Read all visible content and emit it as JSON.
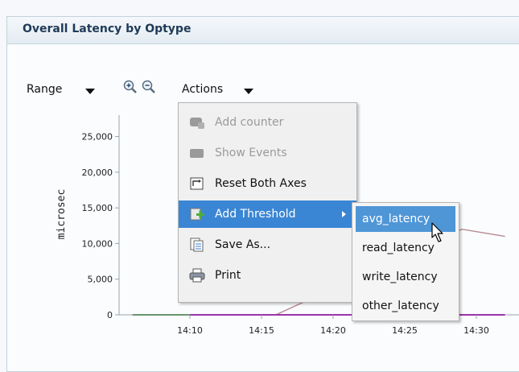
{
  "panel": {
    "title": "Overall Latency by Optype"
  },
  "toolbar": {
    "range_label": "Range",
    "actions_label": "Actions"
  },
  "chart_data": {
    "type": "line",
    "ylabel": "microsec",
    "y_ticks": [
      "0",
      "5,000",
      "10,000",
      "15,000",
      "20,000",
      "25,000"
    ],
    "x_ticks": [
      "14:10",
      "14:15",
      "14:20",
      "14:25",
      "14:30"
    ],
    "ylim": [
      0,
      28000
    ],
    "series": [
      {
        "color": "#b98a8f",
        "points": [
          [
            "14:06",
            0
          ],
          [
            "14:16",
            0
          ],
          [
            "14:29",
            12000
          ],
          [
            "14:32",
            11000
          ]
        ]
      },
      {
        "color": "#9b33a9",
        "points": [
          [
            "14:06",
            0
          ],
          [
            "14:32",
            0
          ]
        ]
      },
      {
        "color": "#58b85a",
        "points": [
          [
            "14:06",
            0
          ],
          [
            "14:10",
            0
          ]
        ]
      }
    ]
  },
  "menu": {
    "items": [
      {
        "label": "Add counter",
        "icon": "add-counter-icon",
        "disabled": true
      },
      {
        "label": "Show Events",
        "icon": "show-events-icon",
        "disabled": true
      },
      {
        "label": "Reset Both Axes",
        "icon": "reset-axes-icon",
        "disabled": false
      },
      {
        "label": "Add Threshold",
        "icon": "add-threshold-icon",
        "disabled": false,
        "active": true
      },
      {
        "label": "Save As...",
        "icon": "save-as-icon",
        "disabled": false
      },
      {
        "label": "Print",
        "icon": "print-icon",
        "disabled": false
      }
    ]
  },
  "submenu": {
    "items": [
      {
        "label": "avg_latency",
        "active": true
      },
      {
        "label": "read_latency"
      },
      {
        "label": "write_latency"
      },
      {
        "label": "other_latency"
      }
    ]
  }
}
